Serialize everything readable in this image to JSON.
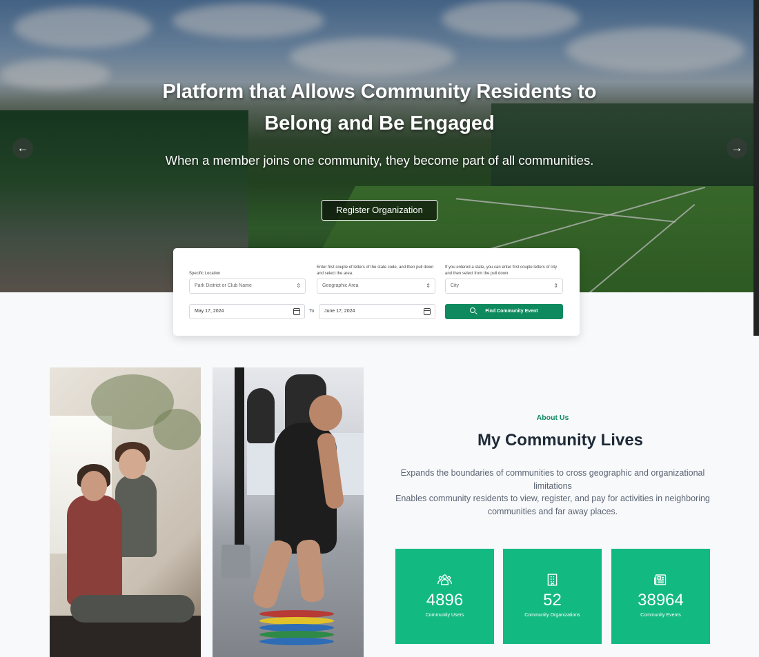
{
  "hero": {
    "title_line1": "Platform that Allows Community Residents to",
    "title_line2": "Belong and Be Engaged",
    "subtitle": "When a member joins one community, they become part of all communities.",
    "register_button": "Register Organization",
    "prev_arrow": "←",
    "next_arrow": "→"
  },
  "search": {
    "location_label": "Specific Location",
    "location_placeholder": "Park District or Club Name",
    "area_label": "Enter first couple of letters of the state code, and then pull down and select the area.",
    "area_placeholder": "Geographic Area",
    "city_label": "If you entered a state, you can enter first couple letters of city and then select from the pull down",
    "city_placeholder": "City",
    "start_date": "May 17, 2024",
    "to_label": "To",
    "end_date": "June 17, 2024",
    "find_button": "Find Community Event"
  },
  "about": {
    "kicker": "About Us",
    "title": "My Community Lives",
    "line1": "Expands the boundaries of communities to cross geographic and organizational limitations",
    "line2": "Enables community residents to view, register, and pay for activities in neighboring communities and far away places."
  },
  "stats": [
    {
      "icon": "users-icon",
      "value": "4896",
      "label": "Community Users"
    },
    {
      "icon": "building-icon",
      "value": "52",
      "label": "Community Organizations"
    },
    {
      "icon": "newspaper-icon",
      "value": "38964",
      "label": "Community Events"
    }
  ],
  "colors": {
    "accent_green": "#12b981",
    "button_green": "#0f8a5f",
    "title_dark": "#1f2a37"
  }
}
